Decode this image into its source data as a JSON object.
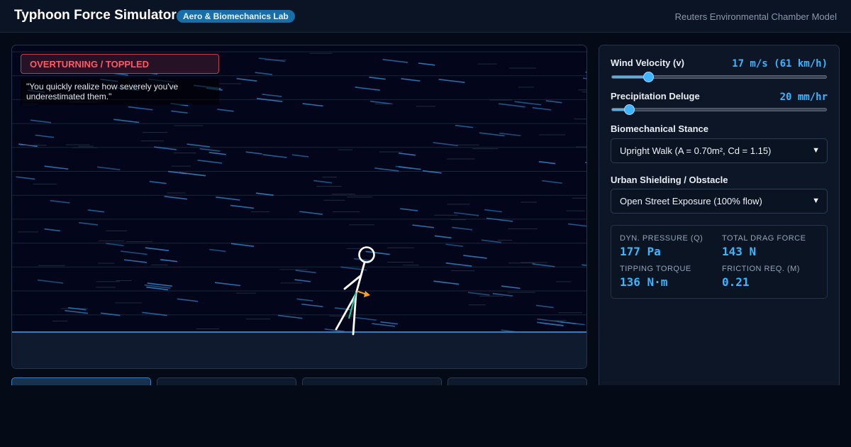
{
  "header": {
    "title": "Typhoon Force Simulator",
    "badge": "Aero & Biomechanics Lab",
    "model_label": "Reuters Environmental Chamber Model"
  },
  "simulation": {
    "status": "OVERTURNING / TOPPLED",
    "quote": "\"You quickly realize how severely you've underestimated them.\""
  },
  "controls": {
    "wind": {
      "label": "Wind Velocity (v)",
      "value": "17 m/s (61 km/h)",
      "fraction": 0.17
    },
    "rain": {
      "label": "Precipitation Deluge",
      "value": "20 mm/hr",
      "fraction": 0.08
    },
    "stance": {
      "label": "Biomechanical Stance",
      "selected": "Upright Walk (A = 0.70m², Cd = 1.15)"
    },
    "shield": {
      "label": "Urban Shielding / Obstacle",
      "selected": "Open Street Exposure (100% flow)"
    }
  },
  "metrics": {
    "pressure": {
      "label": "DYN. PRESSURE (Q)",
      "value": "177 Pa"
    },
    "drag": {
      "label": "TOTAL DRAG FORCE",
      "value": "143 N"
    },
    "torque": {
      "label": "TIPPING TORQUE",
      "value": "136 N·m"
    },
    "friction": {
      "label": "FRICTION REQ. (M)",
      "value": "0.21"
    }
  },
  "colors": {
    "accent": "#3fb4ff",
    "danger": "#ff5964",
    "ground": "#2f7fbf"
  }
}
